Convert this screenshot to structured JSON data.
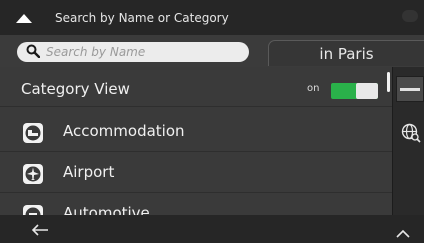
{
  "header": {
    "title": "Search by Name or Category"
  },
  "search": {
    "placeholder": "Search by Name",
    "location_button": "in Paris"
  },
  "category_view": {
    "label": "Category View",
    "toggle_state_text": "on"
  },
  "categories": [
    {
      "label": "Accommodation",
      "icon": "bed-icon"
    },
    {
      "label": "Airport",
      "icon": "airplane-icon"
    },
    {
      "label": "Automotive",
      "icon": "car-icon"
    }
  ],
  "colors": {
    "toggle_on": "#2ab14a",
    "header_bg": "#262626",
    "list_bg": "#3a3a3a"
  }
}
